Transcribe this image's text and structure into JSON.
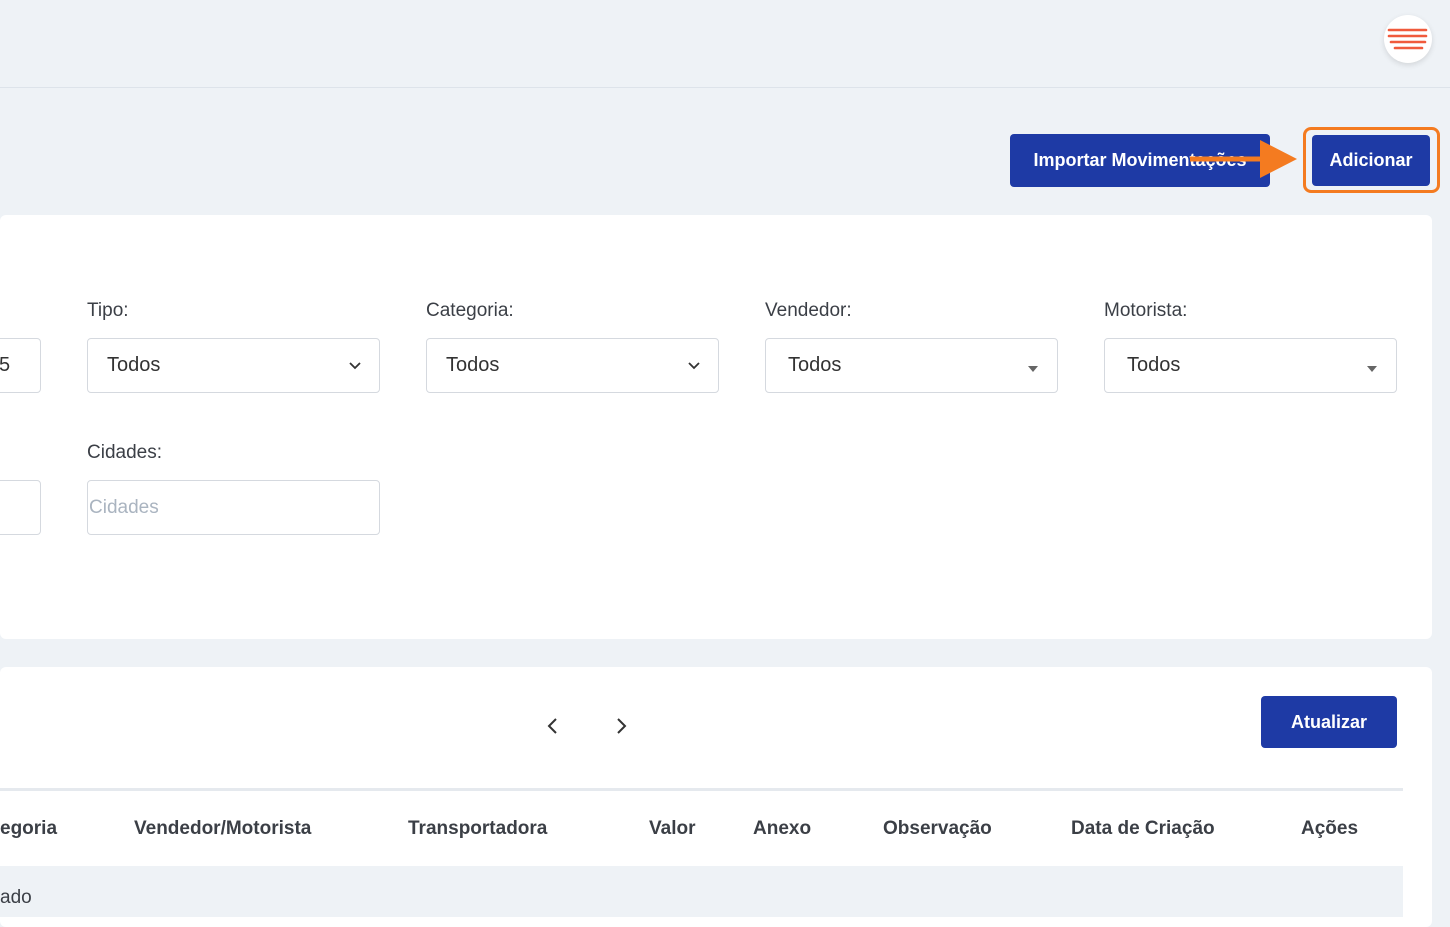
{
  "header": {
    "actions": {
      "import_label": "Importar Movimentações",
      "add_label": "Adicionar"
    }
  },
  "filters": {
    "partial_value": "5",
    "tipo": {
      "label": "Tipo:",
      "value": "Todos"
    },
    "categoria": {
      "label": "Categoria:",
      "value": "Todos"
    },
    "vendedor": {
      "label": "Vendedor:",
      "value": "Todos"
    },
    "motorista": {
      "label": "Motorista:",
      "value": "Todos"
    },
    "cidades": {
      "label": "Cidades:",
      "value": "",
      "placeholder": "Cidades"
    }
  },
  "list": {
    "refresh_label": "Atualizar",
    "columns": [
      "egoria",
      "Vendedor/Motorista",
      "Transportadora",
      "Valor",
      "Anexo",
      "Observação",
      "Data de Criação",
      "Ações"
    ],
    "first_row_partial": "ado"
  },
  "colors": {
    "primary": "#1e3aa5",
    "highlight": "#f47b20",
    "background": "#eef2f6"
  },
  "icons": {
    "avatar": "stacked-lines-icon",
    "prev": "chevron-left-icon",
    "next": "chevron-right-icon",
    "select_chevron": "chevron-down-icon",
    "select_caret": "caret-down-icon"
  }
}
